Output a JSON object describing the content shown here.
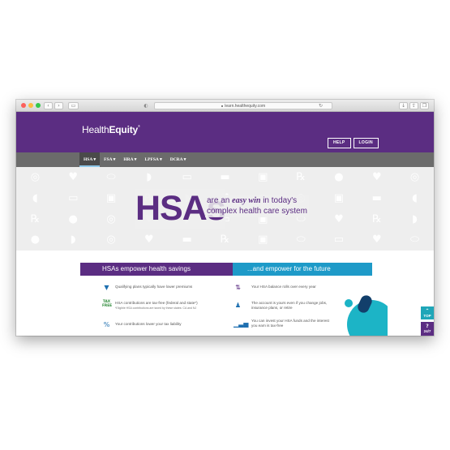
{
  "browser": {
    "url": "learn.healthequity.com"
  },
  "header": {
    "logo_regular": "Health",
    "logo_bold": "Equity",
    "logo_mark": "®",
    "help_label": "HELP",
    "login_label": "LOGIN"
  },
  "nav": {
    "items": [
      {
        "label": "HSA ▾"
      },
      {
        "label": "FSA ▾"
      },
      {
        "label": "HRA ▾"
      },
      {
        "label": "LPFSA ▾"
      },
      {
        "label": "DCRA ▾"
      }
    ]
  },
  "hero": {
    "title": "HSAs",
    "line1_pre": "are an ",
    "line1_em": "easy win",
    "line1_post": " in today's",
    "line2": "complex health care system"
  },
  "banners": {
    "left": "HSAs empower health savings",
    "right": "...and empower for the future"
  },
  "features_left": [
    {
      "icon": "dollar-down-icon",
      "text": "Qualifying plans typically have lower premiums",
      "note": ""
    },
    {
      "icon": "tax-free-icon",
      "icon_text": "TAX FREE",
      "text": "HSA contributions are tax-free (federal and state*)",
      "note": "*Eligible HSA contributions are taxed by these states: CA and NJ"
    },
    {
      "icon": "percent-down-icon",
      "text": "Your contributions lower your tax liability",
      "note": ""
    }
  ],
  "features_right": [
    {
      "icon": "rollover-arrows-icon",
      "text": "Your HSA balance rolls over every year"
    },
    {
      "icon": "person-portable-icon",
      "text": "The account is yours even if you change jobs, insurance plans, or retire"
    },
    {
      "icon": "growth-bars-icon",
      "text": "You can invest your HSA funds and the interest you earn is tax-free"
    }
  ],
  "side_tabs": {
    "top_label": "TOP",
    "support_label": "24/7"
  }
}
